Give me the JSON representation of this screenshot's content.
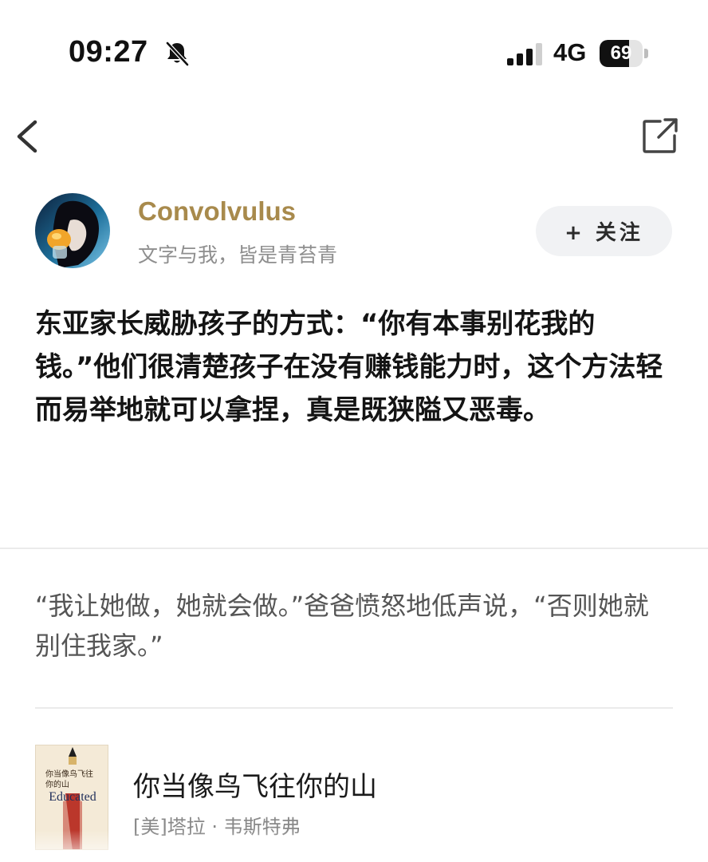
{
  "status_bar": {
    "time": "09:27",
    "network": "4G",
    "battery": "69",
    "battery_fraction": 0.69
  },
  "icons": {
    "back": "back-chevron-icon",
    "share": "share-icon",
    "bell": "bell-slash-icon",
    "signal": "signal-icon",
    "plus": "plus-icon"
  },
  "colors": {
    "author_name": "#a88a4c",
    "follow_bg": "#f1f2f4",
    "divider": "#ebebeb"
  },
  "author": {
    "name": "Convolvulus",
    "bio": "文字与我，皆是青苔青",
    "follow_label": "+ 关注"
  },
  "post": {
    "text": "东亚家长威胁孩子的方式：“你有本事别花我的钱。”他们很清楚孩子在没有赚钱能力时，这个方法轻而易举地就可以拿捏，真是既狭隘又恶毒。"
  },
  "quote": {
    "text": "“我让她做，她就会做。”爸爸愤怒地低声说，“否则她就别住我家。”"
  },
  "book": {
    "title": "你当像鸟飞往你的山",
    "author": "[美]塔拉 · 韦斯特弗",
    "cover_title": "你当像鸟飞往你的山",
    "cover_en": "Educated"
  }
}
